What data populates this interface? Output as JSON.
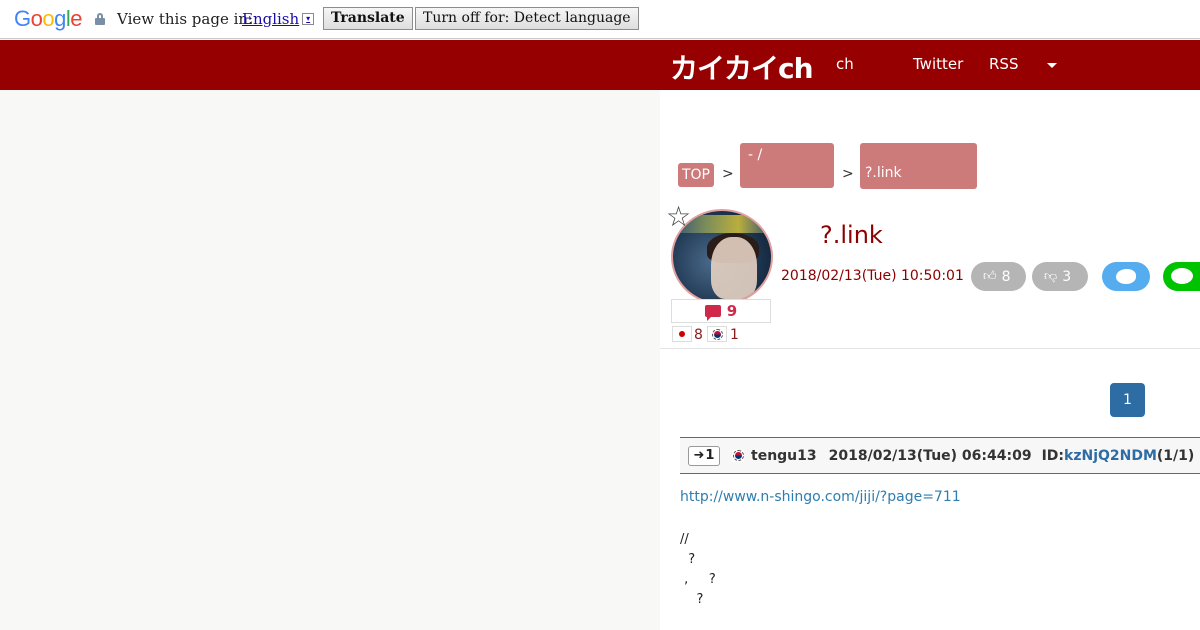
{
  "translate_bar": {
    "logo": "Google",
    "prompt": "View this page in:",
    "language": "English",
    "language_arrow": "▾",
    "translate_label": "Translate",
    "turn_off_label": "Turn off for: Detect language"
  },
  "header": {
    "logo": "カイカイch",
    "nav": [
      "ch",
      "Twitter",
      "RSS"
    ],
    "accent": "#970000"
  },
  "breadcrumb": {
    "top": "TOP",
    "sep": ">",
    "category": "- /",
    "current": "?.link",
    "color": "#cc7a7a"
  },
  "article": {
    "title": "?.link",
    "date": "2018/02/13(Tue) 10:50:01",
    "comment_count": "9",
    "jp_count": "8",
    "kr_count": "1",
    "likes": "8",
    "dislikes": "3"
  },
  "pagination": {
    "current_page": "1"
  },
  "post": {
    "number": "1",
    "user": "tengu13",
    "date": "2018/02/13(Tue) 06:44:09",
    "id_label": "ID:",
    "id": "kzNjQ2NDM",
    "id_count": "(1/1)",
    "link": "http://www.n-shingo.com/jiji/?page=711",
    "lines": [
      "//",
      "  ?",
      "",
      " ,     ?",
      "    ?"
    ]
  }
}
